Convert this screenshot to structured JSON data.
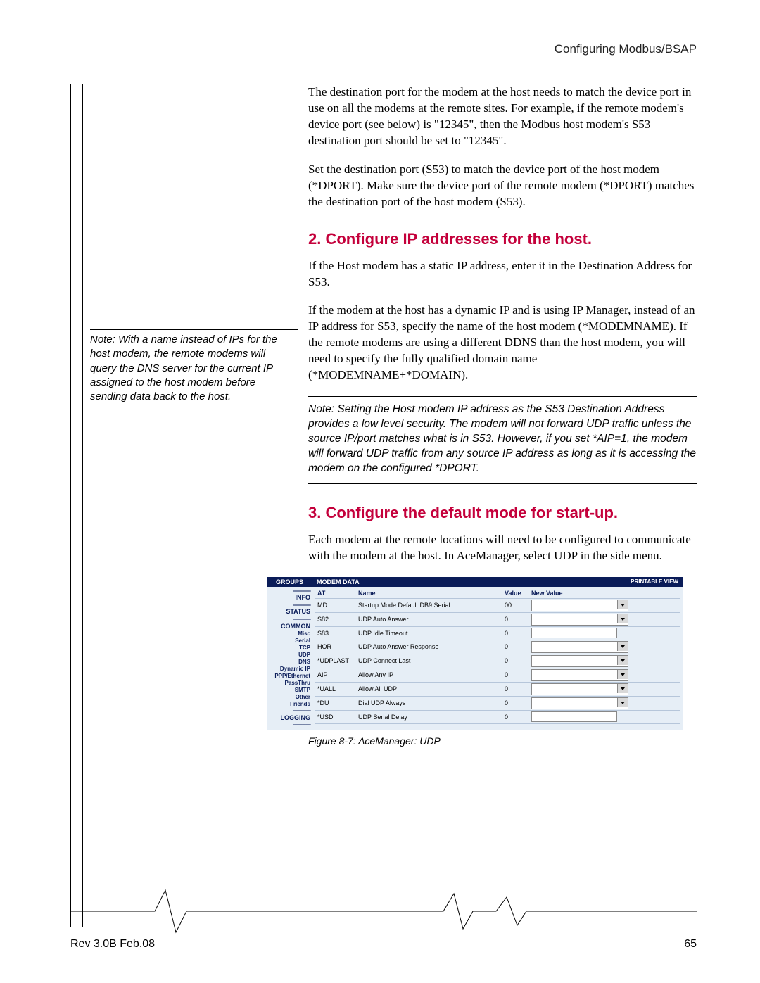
{
  "header": {
    "section_title": "Configuring Modbus/BSAP"
  },
  "para1": "The destination port for the modem at the host needs to match the device port in use on all the modems at the remote sites. For example, if the remote modem's device port (see below) is \"12345\", then the Modbus host modem's S53 destination port should be set to \"12345\".",
  "para2": "Set the destination port (S53) to match the device port of the host modem (*DPORT). Make sure the device port of the remote modem (*DPORT) matches the destination port of the host modem (S53).",
  "heading2": "2. Configure IP addresses for the host.",
  "para3": "If the Host modem has a static IP address, enter it in the Destination Address for S53.",
  "side_note": "Note: With a name instead of IPs for the host modem, the remote modems will query the DNS server for the current IP assigned to the host modem before sending data back to the host.",
  "para4": "If the modem at the host has a dynamic IP and is using IP Manager, instead of an IP address for S53, specify the name of the host modem (*MODEMNAME). If the remote modems are using a different DDNS than the host modem, you will need to specify the fully qualified domain name (*MODEMNAME+*DOMAIN).",
  "inline_note": "Note: Setting the Host modem IP address as the S53 Destination Address provides a low level security. The modem will not forward UDP traffic unless the source IP/port matches what is in S53. However, if you set *AIP=1, the modem will forward UDP traffic from any source IP address as long as it is accessing the modem on the configured *DPORT.",
  "heading3": "3. Configure the default mode for start-up.",
  "para5": "Each modem at the remote locations will need to be configured to communicate with the modem at the host. In AceManager, select UDP in the side menu.",
  "screenshot": {
    "bar_groups": "GROUPS",
    "bar_modem": "MODEM DATA",
    "bar_print": "PRINTABLE VIEW",
    "side_items": [
      "INFO",
      "STATUS",
      "COMMON",
      "Misc",
      "Serial",
      "TCP",
      "UDP",
      "DNS",
      "Dynamic IP",
      "PPP/Ethernet",
      "PassThru",
      "SMTP",
      "Other",
      "Friends",
      "LOGGING"
    ],
    "cols": {
      "at": "AT",
      "name": "Name",
      "value": "Value",
      "newvalue": "New Value"
    },
    "rows": [
      {
        "at": "MD",
        "name": "Startup Mode Default DB9 Serial",
        "value": "00",
        "type": "select"
      },
      {
        "at": "S82",
        "name": "UDP Auto Answer",
        "value": "0",
        "type": "select"
      },
      {
        "at": "S83",
        "name": "UDP Idle Timeout",
        "value": "0",
        "type": "input"
      },
      {
        "at": "HOR",
        "name": "UDP Auto Answer Response",
        "value": "0",
        "type": "select"
      },
      {
        "at": "*UDPLAST",
        "name": "UDP Connect Last",
        "value": "0",
        "type": "select"
      },
      {
        "at": "AIP",
        "name": "Allow Any IP",
        "value": "0",
        "type": "select"
      },
      {
        "at": "*UALL",
        "name": "Allow All UDP",
        "value": "0",
        "type": "select"
      },
      {
        "at": "*DU",
        "name": "Dial UDP Always",
        "value": "0",
        "type": "select"
      },
      {
        "at": "*USD",
        "name": "UDP Serial Delay",
        "value": "0",
        "type": "input"
      }
    ]
  },
  "figure_caption": "Figure 8-7: AceManager: UDP",
  "footer": {
    "rev": "Rev 3.0B  Feb.08",
    "page": "65"
  }
}
